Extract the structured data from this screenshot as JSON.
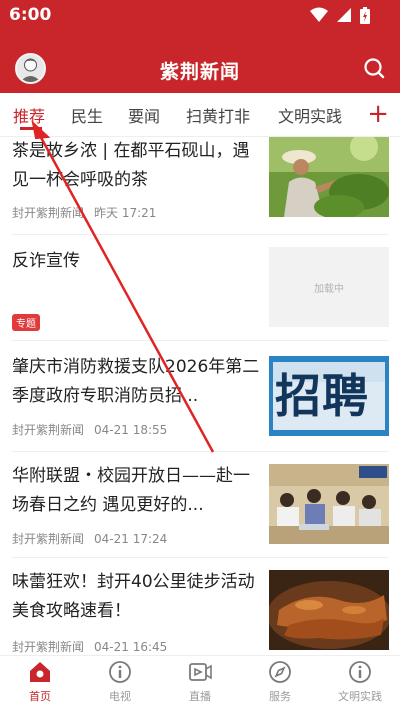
{
  "status_bar": {
    "time": "6:00"
  },
  "header": {
    "title": "紫荆新闻"
  },
  "tabs": [
    {
      "label": "推荐",
      "active": true
    },
    {
      "label": "民生",
      "active": false
    },
    {
      "label": "要闻",
      "active": false
    },
    {
      "label": "扫黄打非",
      "active": false
    },
    {
      "label": "文明实践",
      "active": false
    }
  ],
  "tab_add": "+",
  "feed": [
    {
      "title": "茶是故乡浓 | 在都平石砚山，遇见一杯会呼吸的茶",
      "source": "封开紫荆新闻",
      "time": "昨天 17:21",
      "thumb": "tea-picking-photo"
    },
    {
      "title": "反诈宣传",
      "badge": "专题",
      "thumb_text": "加载中"
    },
    {
      "title": "肇庆市消防救援支队2026年第二季度政府专职消防员招...",
      "source": "封开紫荆新闻",
      "time": "04-21 18:55",
      "thumb": "recruitment-poster",
      "thumb_text": "招聘"
    },
    {
      "title": "华附联盟・校园开放日——赴一场春日之约 遇见更好的...",
      "source": "封开紫荆新闻",
      "time": "04-21 17:24",
      "thumb": "classroom-photo"
    },
    {
      "title": "味蕾狂欢！封开40公里徒步活动美食攻略速看！",
      "source": "封开紫荆新闻",
      "time": "04-21 16:45",
      "thumb": "food-photo"
    }
  ],
  "bottom_nav": [
    {
      "label": "首页",
      "icon": "home-icon",
      "active": true
    },
    {
      "label": "电视",
      "icon": "info-circle-icon",
      "active": false
    },
    {
      "label": "直播",
      "icon": "play-icon",
      "active": false
    },
    {
      "label": "服务",
      "icon": "compass-icon",
      "active": false
    },
    {
      "label": "文明实践",
      "icon": "info-circle-icon",
      "active": false
    }
  ],
  "colors": {
    "brand": "#c8262b",
    "text": "#222222",
    "meta": "#888888"
  }
}
